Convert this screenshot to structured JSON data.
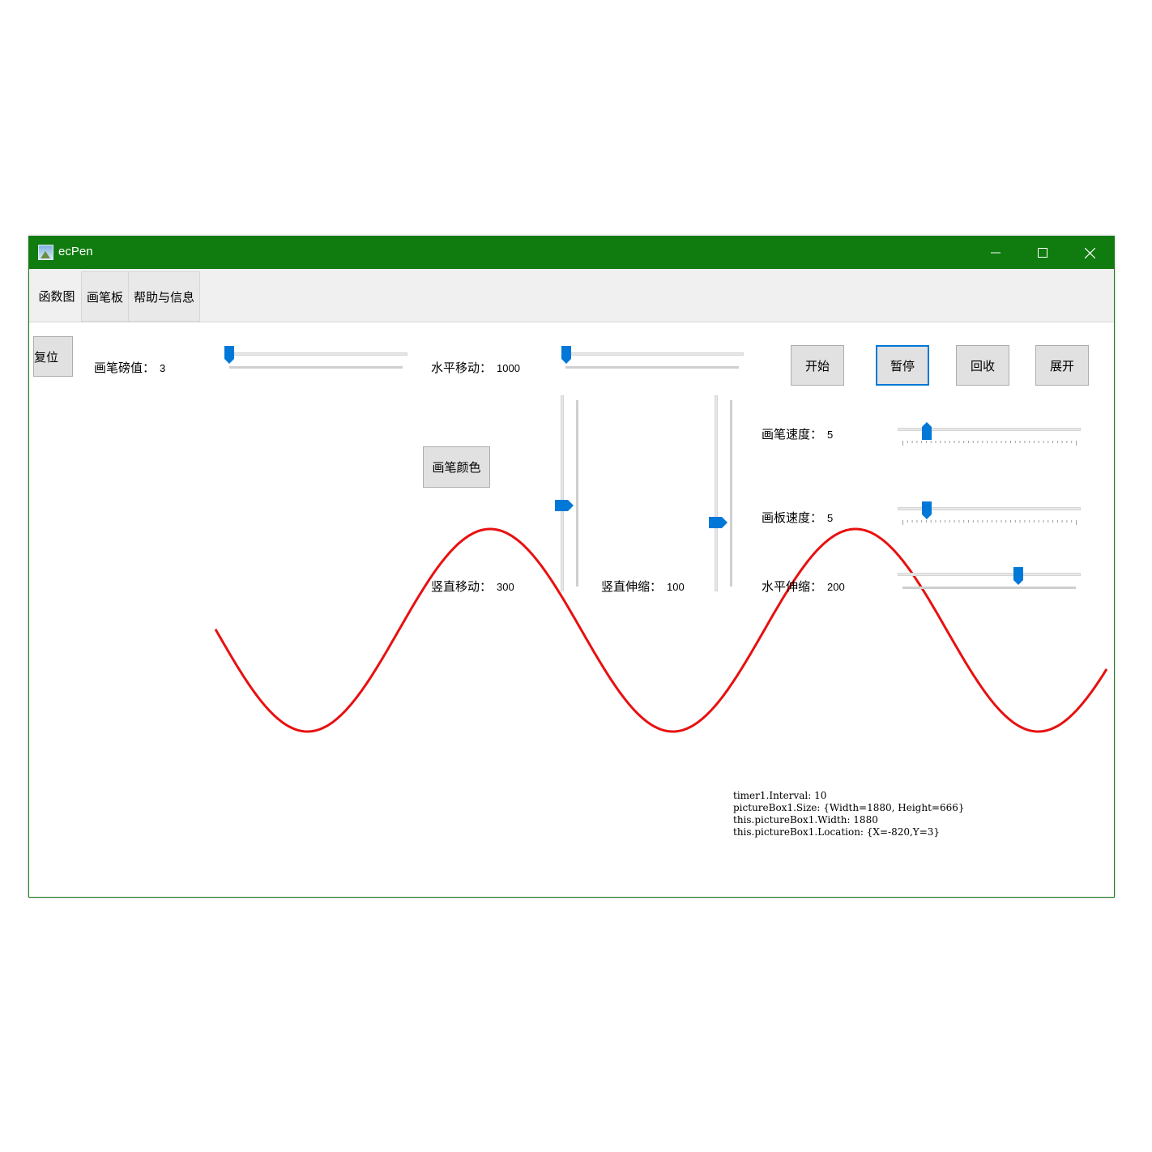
{
  "window": {
    "title": "ecPen",
    "title_bar_color": "#107c10",
    "controls": {
      "minimize_icon": "minimize-icon",
      "maximize_icon": "maximize-icon",
      "close_icon": "close-icon"
    }
  },
  "tabs": [
    {
      "label": "函数图",
      "selected": true
    },
    {
      "label": "画笔板",
      "selected": false
    },
    {
      "label": "帮助与信息",
      "selected": false
    }
  ],
  "buttons": {
    "reset": "复位",
    "start": "开始",
    "pause": "暂停",
    "collapse": "回收",
    "expand": "展开",
    "pen_color": "画笔颜色"
  },
  "controls": {
    "pen_weight": {
      "label": "画笔磅值：",
      "value": "3",
      "level": 0.0
    },
    "horizontal_move": {
      "label": "水平移动：",
      "value": "1000",
      "level": 0.0
    },
    "vertical_move": {
      "label": "竖直移动：",
      "value": "300",
      "level": 0.56
    },
    "vertical_stretch": {
      "label": "竖直伸缩：",
      "value": "100",
      "level": 0.65
    },
    "pen_speed": {
      "label": "画笔速度：",
      "value": "5",
      "level": 0.16
    },
    "board_speed": {
      "label": "画板速度：",
      "value": "5",
      "level": 0.16
    },
    "horizontal_stretch": {
      "label": "水平伸缩：",
      "value": "200",
      "level": 0.67
    }
  },
  "slider_color": "#0078d7",
  "curve": {
    "color": "#e81010",
    "shape": "sine",
    "line_width": 3
  },
  "debug_info": {
    "line1": "timer1.Interval: 10",
    "line2": "pictureBox1.Size: {Width=1880, Height=666}",
    "line3": "this.pictureBox1.Width: 1880",
    "line4": "this.pictureBox1.Location: {X=-820,Y=3}"
  }
}
